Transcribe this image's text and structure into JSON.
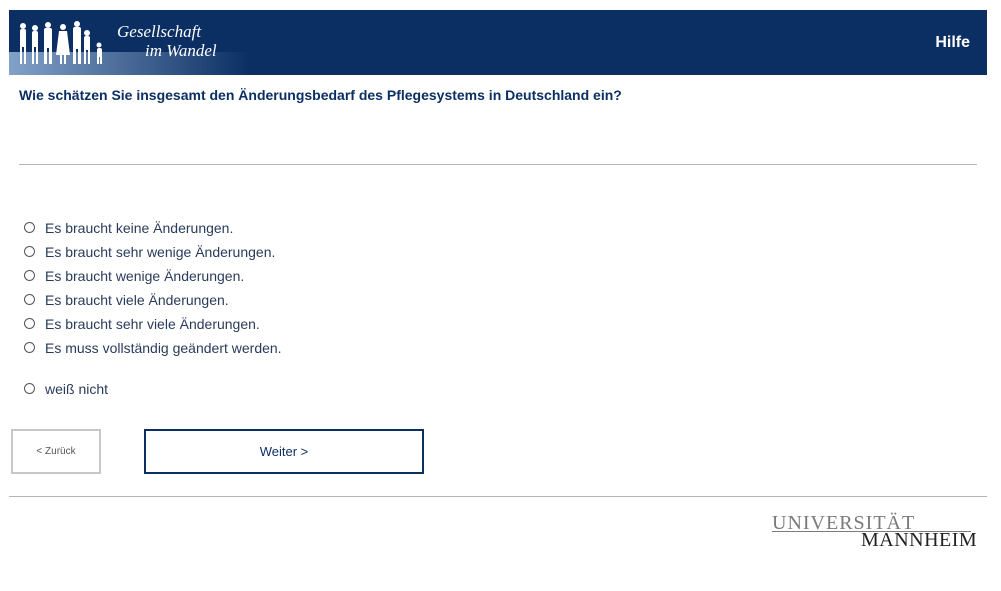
{
  "header": {
    "logo_line1": "Gesellschaft",
    "logo_line2": "im Wandel",
    "help_label": "Hilfe"
  },
  "question": "Wie schätzen Sie insgesamt den Änderungsbedarf des Pflegesystems in Deutschland ein?",
  "options": [
    "Es braucht keine Änderungen.",
    "Es braucht sehr wenige Änderungen.",
    "Es braucht wenige Änderungen.",
    "Es braucht viele Änderungen.",
    "Es braucht sehr viele Änderungen.",
    "Es muss vollständig geändert werden."
  ],
  "dont_know": "weiß nicht",
  "nav": {
    "back_label": "< Zurück",
    "next_label": "Weiter >"
  },
  "footer": {
    "university_line1": "UNIVERSITÄT",
    "university_line2": "MANNHEIM"
  },
  "colors": {
    "brand_navy": "#0c2f63"
  }
}
